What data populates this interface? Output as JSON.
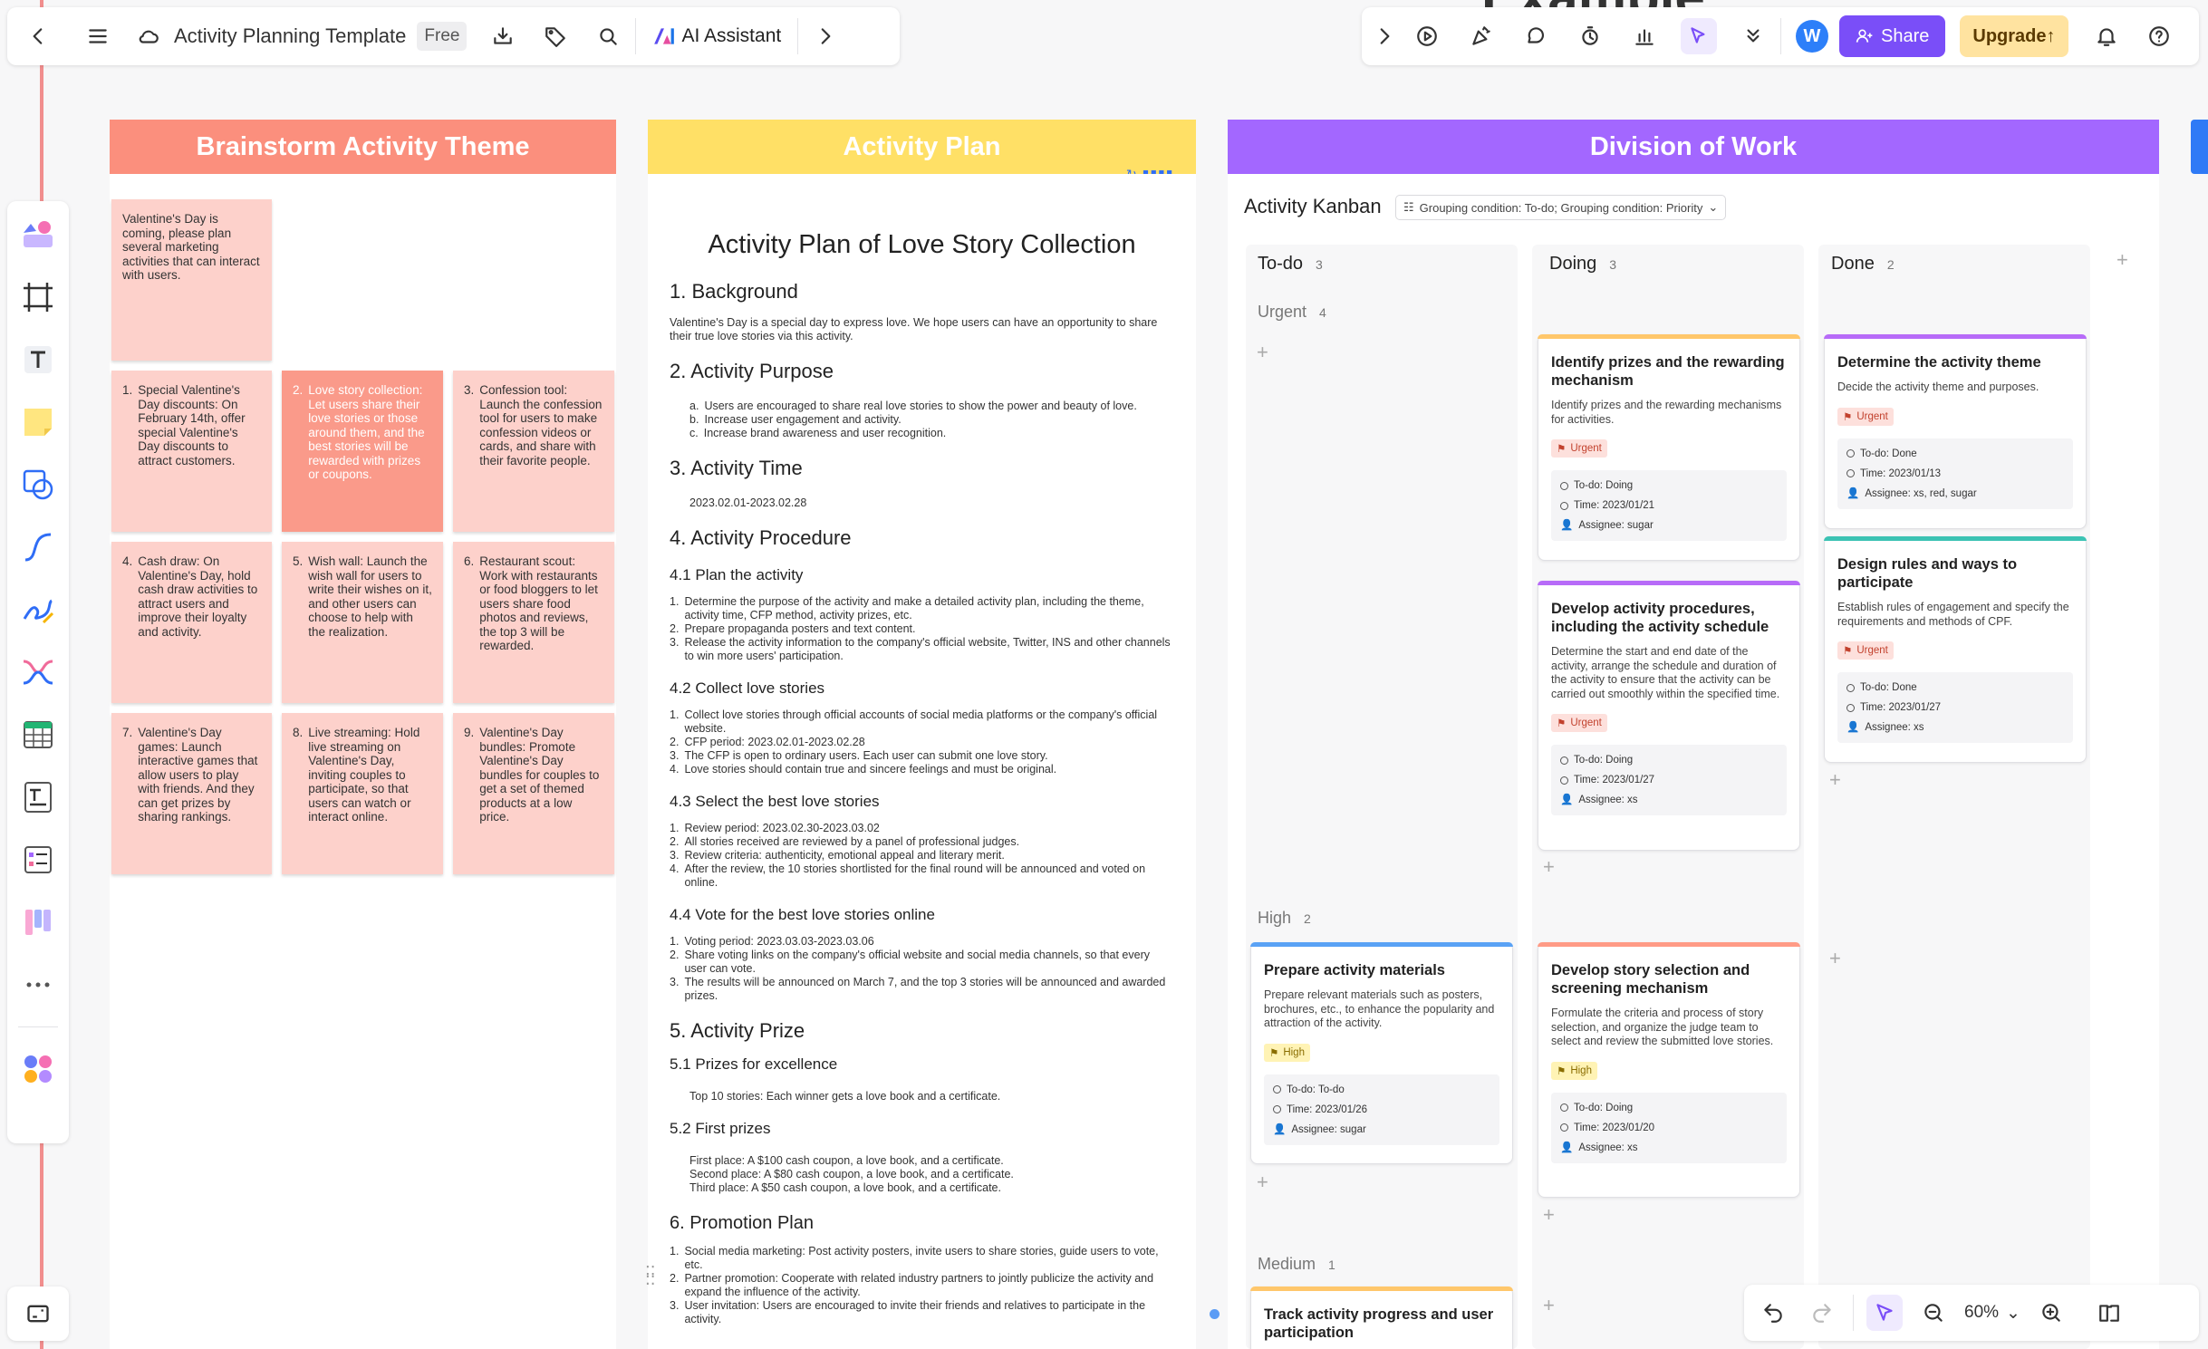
{
  "app": {
    "doc_title": "Activity Planning Template",
    "plan_badge": "Free",
    "ai_label": "AI Assistant",
    "avatar_letter": "W",
    "share_label": "Share",
    "upgrade_label": "Upgrade",
    "zoom": "60%",
    "watermark": "Example"
  },
  "colors": {
    "brainstorm": "#fb8f7d",
    "plan": "#ffe066",
    "division": "#a367ff",
    "accent": "#7a4ef8"
  },
  "brainstorm": {
    "header": "Brainstorm Activity Theme",
    "intro": "Valentine's Day is coming, please plan several marketing activities that can interact with users.",
    "notes": [
      {
        "n": "1.",
        "text": "Special Valentine's Day discounts: On February 14th, offer special Valentine's Day discounts to attract customers."
      },
      {
        "n": "2.",
        "text": "Love story collection: Let users share their love stories or those around them, and the best stories will be rewarded with prizes or coupons."
      },
      {
        "n": "3.",
        "text": "Confession tool: Launch the confession tool for users to make confession videos or cards, and share with their favorite people."
      },
      {
        "n": "4.",
        "text": "Cash draw: On Valentine's Day, hold cash draw activities to attract users and improve their loyalty and activity."
      },
      {
        "n": "5.",
        "text": "Wish wall: Launch the wish wall for users to write their wishes on it, and other users can choose to help with the realization."
      },
      {
        "n": "6.",
        "text": "Restaurant scout: Work with restaurants or food bloggers to let users share food photos and reviews, the top 3 will be rewarded."
      },
      {
        "n": "7.",
        "text": "Valentine's Day games: Launch interactive games that allow users to play with friends. And they can get prizes by sharing rankings."
      },
      {
        "n": "8.",
        "text": "Live streaming: Hold live streaming on Valentine's Day, inviting couples to participate, so that users can watch or interact online."
      },
      {
        "n": "9.",
        "text": "Valentine's Day bundles: Promote Valentine's Day bundles for couples to get a set of themed products at a low price."
      }
    ]
  },
  "plan": {
    "header": "Activity Plan",
    "title": "Activity Plan of Love Story Collection",
    "s1": "1.  Background",
    "s1_text": "Valentine's Day is a special day to express love. We hope users can have an opportunity to share their true love stories via this activity.",
    "s2": "2.  Activity Purpose",
    "s2_items": [
      {
        "n": "a.",
        "t": "Users are encouraged to share real love stories to show the power and beauty of love."
      },
      {
        "n": "b.",
        "t": "Increase user engagement and activity."
      },
      {
        "n": "c.",
        "t": "Increase brand awareness and user recognition."
      }
    ],
    "s3": "3.  Activity Time",
    "s3_text": "2023.02.01-2023.02.28",
    "s4": "4.  Activity Procedure",
    "s41": "4.1 Plan the activity",
    "s41_items": [
      {
        "n": "1.",
        "t": "Determine the purpose of the activity and make a detailed activity plan, including the theme, activity time, CFP method, activity prizes, etc."
      },
      {
        "n": "2.",
        "t": "Prepare propaganda posters and text content."
      },
      {
        "n": "3.",
        "t": "Release the activity information to the company's official website, Twitter, INS and other channels to win more users' participation."
      }
    ],
    "s42": "4.2 Collect love stories",
    "s42_items": [
      {
        "n": "1.",
        "t": "Collect love stories through official accounts of social media platforms or the company's official website."
      },
      {
        "n": "2.",
        "t": "CFP period: 2023.02.01-2023.02.28"
      },
      {
        "n": "3.",
        "t": "The CFP is open to ordinary users. Each user can submit one love story."
      },
      {
        "n": "4.",
        "t": "Love stories should contain true and sincere feelings and must be original."
      }
    ],
    "s43": "4.3 Select the best love stories",
    "s43_items": [
      {
        "n": "1.",
        "t": "Review period: 2023.02.30-2023.03.02"
      },
      {
        "n": "2.",
        "t": "All stories received are reviewed by a panel of professional judges."
      },
      {
        "n": "3.",
        "t": "Review criteria: authenticity, emotional appeal and literary merit."
      },
      {
        "n": "4.",
        "t": "After the review, the 10 stories shortlisted for the final round will be announced and voted on online."
      }
    ],
    "s44": "4.4 Vote for the best love stories online",
    "s44_items": [
      {
        "n": "1.",
        "t": "Voting period: 2023.03.03-2023.03.06"
      },
      {
        "n": "2.",
        "t": "Share voting links on the company's official website and social media channels, so that every user can vote."
      },
      {
        "n": "3.",
        "t": "The results will be announced on March 7, and the top 3 stories will be announced and awarded prizes."
      }
    ],
    "s5": "5.  Activity Prize",
    "s51": "5.1 Prizes for excellence",
    "s51_text": "Top 10 stories: Each winner gets a love book and a certificate.",
    "s52": "5.2 First prizes",
    "s52_lines": [
      "First place: A $100 cash coupon, a love book, and a certificate.",
      "Second place: A $80 cash coupon, a love book, and a certificate.",
      "Third place: A $50 cash coupon, a love book, and a certificate."
    ],
    "s6": "6. Promotion Plan",
    "s6_items": [
      {
        "n": "1.",
        "t": "Social media marketing: Post activity posters, invite users to share stories, guide users to vote, etc."
      },
      {
        "n": "2.",
        "t": "Partner promotion: Cooperate with related industry partners to jointly publicize the activity and expand the influence of the activity."
      },
      {
        "n": "3.",
        "t": "User invitation: Users are encouraged to invite their friends and relatives to participate in the activity."
      }
    ]
  },
  "division": {
    "header": "Division of Work",
    "kanban_title": "Activity Kanban",
    "grouping": "Grouping condition: To-do; Grouping condition: Priority",
    "columns": [
      {
        "name": "To-do",
        "count": "3"
      },
      {
        "name": "Doing",
        "count": "3"
      },
      {
        "name": "Done",
        "count": "2"
      }
    ],
    "lanes": [
      {
        "name": "Urgent",
        "count": "4"
      },
      {
        "name": "High",
        "count": "2"
      },
      {
        "name": "Medium",
        "count": "1"
      }
    ],
    "cards": {
      "c1": {
        "title": "Identify prizes and the rewarding mechanism",
        "desc": "Identify prizes and the rewarding mechanisms for activities.",
        "tag": "Urgent",
        "status": "To-do: Doing",
        "time": "Time: 2023/01/21",
        "assignee": "Assignee: sugar"
      },
      "c2": {
        "title": "Develop activity procedures, including the activity schedule",
        "desc": "Determine the start and end date of the activity, arrange the schedule and duration of the activity to ensure that the activity can be carried out smoothly within the specified time.",
        "tag": "Urgent",
        "status": "To-do: Doing",
        "time": "Time: 2023/01/27",
        "assignee": "Assignee: xs"
      },
      "c3": {
        "title": "Determine the activity theme",
        "desc": "Decide the activity theme and purposes.",
        "tag": "Urgent",
        "status": "To-do: Done",
        "time": "Time: 2023/01/13",
        "assignee": "Assignee: xs, red, sugar"
      },
      "c4": {
        "title": "Design rules and ways to participate",
        "desc": "Establish rules of engagement and specify the requirements and methods of CPF.",
        "tag": "Urgent",
        "status": "To-do: Done",
        "time": "Time: 2023/01/27",
        "assignee": "Assignee: xs"
      },
      "c5": {
        "title": "Prepare activity materials",
        "desc": "Prepare relevant materials such as posters, brochures, etc., to enhance the popularity and attraction of the activity.",
        "tag": "High",
        "status": "To-do: To-do",
        "time": "Time: 2023/01/26",
        "assignee": "Assignee: sugar"
      },
      "c6": {
        "title": "Develop story selection and screening mechanism",
        "desc": "Formulate the criteria and process of story selection, and organize the judge team to select and review the submitted love stories.",
        "tag": "High",
        "status": "To-do: Doing",
        "time": "Time: 2023/01/20",
        "assignee": "Assignee: xs"
      },
      "c7": {
        "title": "Track activity progress and user participation"
      }
    }
  }
}
